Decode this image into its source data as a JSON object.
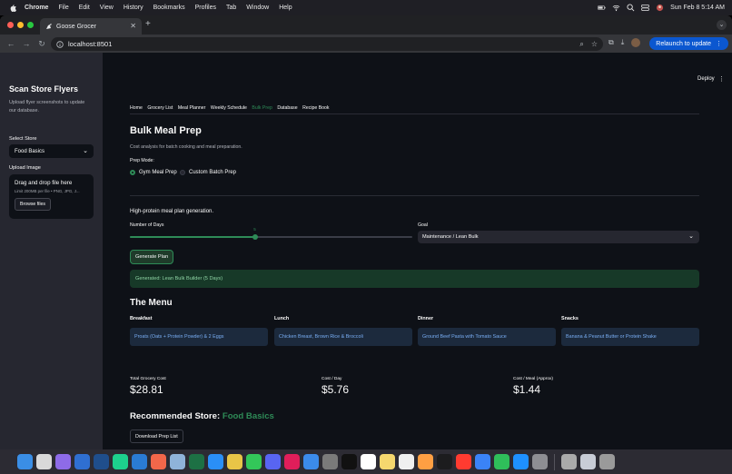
{
  "menubar": {
    "app_name": "Chrome",
    "items": [
      "File",
      "Edit",
      "View",
      "History",
      "Bookmarks",
      "Profiles",
      "Tab",
      "Window",
      "Help"
    ],
    "datetime": "Sun Feb 8  5:14 AM"
  },
  "browser": {
    "tab_title": "Goose Grocer",
    "url": "localhost:8501",
    "relaunch_label": "Relaunch to update"
  },
  "sidebar": {
    "title": "Scan Store Flyers",
    "description": "Upload flyer screenshots to update our database.",
    "select_store_label": "Select Store",
    "select_store_value": "Food Basics",
    "upload_label": "Upload Image",
    "upload_drag": "Drag and drop file here",
    "upload_limit": "Limit 200MB per file • PNG, JPG, J...",
    "browse_label": "Browse files"
  },
  "header": {
    "deploy_label": "Deploy"
  },
  "nav_tabs": [
    {
      "label": "Home",
      "active": false
    },
    {
      "label": "Grocery List",
      "active": false
    },
    {
      "label": "Meal Planner",
      "active": false
    },
    {
      "label": "Weekly Schedule",
      "active": false
    },
    {
      "label": "Bulk Prep",
      "active": true
    },
    {
      "label": "Database",
      "active": false
    },
    {
      "label": "Recipe Book",
      "active": false
    }
  ],
  "page": {
    "title": "Bulk Meal Prep",
    "description": "Cost analysis for batch cooking and meal preparation.",
    "prep_mode_label": "Prep Mode:",
    "prep_modes": [
      {
        "label": "Gym Meal Prep",
        "selected": true
      },
      {
        "label": "Custom Batch Prep",
        "selected": false
      }
    ],
    "plan_heading": "High-protein meal plan generation.",
    "days_label": "Number of Days",
    "days_value": 5,
    "days_min": 1,
    "days_max": 10,
    "goal_label": "Goal",
    "goal_value": "Maintenance / Lean Bulk",
    "generate_label": "Generate Plan",
    "success_message": "Generated: Lean Bulk Builder (5 Days)",
    "menu_heading": "The Menu",
    "meals": [
      {
        "label": "Breakfast",
        "item": "Proats (Oats + Protein Powder) & 2 Eggs"
      },
      {
        "label": "Lunch",
        "item": "Chicken Breast, Brown Rice & Broccoli"
      },
      {
        "label": "Dinner",
        "item": "Ground Beef Pasta with Tomato Sauce"
      },
      {
        "label": "Snacks",
        "item": "Banana & Peanut Butter or Protein Shake"
      }
    ],
    "metrics": [
      {
        "label": "Total Grocery Cost",
        "value": "$28.81"
      },
      {
        "label": "Cost / Day",
        "value": "$5.76"
      },
      {
        "label": "Cost / Meal (Approx)",
        "value": "$1.44"
      }
    ],
    "recommended_prefix": "Recommended Store: ",
    "recommended_store": "Food Basics",
    "download_label": "Download Prep List"
  },
  "colors": {
    "accent": "#2e8b57",
    "background": "#0e1117",
    "sidebar": "#262730",
    "card_text": "#79aef4"
  },
  "dock_icons": [
    "finder-icon",
    "safari-compass-icon",
    "launchpad-icon",
    "app-store-grid-icon",
    "xcode-icon",
    "pycharm-icon",
    "vscode-icon",
    "figma-icon",
    "preview-icon",
    "excel-icon",
    "safari-icon",
    "chrome-icon",
    "messages-icon",
    "discord-icon",
    "slack-icon",
    "mail-icon",
    "search-icon",
    "terminal-icon",
    "calendar-icon",
    "notes-icon",
    "reminders-icon",
    "photos-icon",
    "apple-tv-icon",
    "news-icon",
    "keynote-icon",
    "numbers-icon",
    "app-store-icon",
    "system-settings-icon",
    "script-editor-icon",
    "finder-window-icon",
    "trash-icon"
  ]
}
